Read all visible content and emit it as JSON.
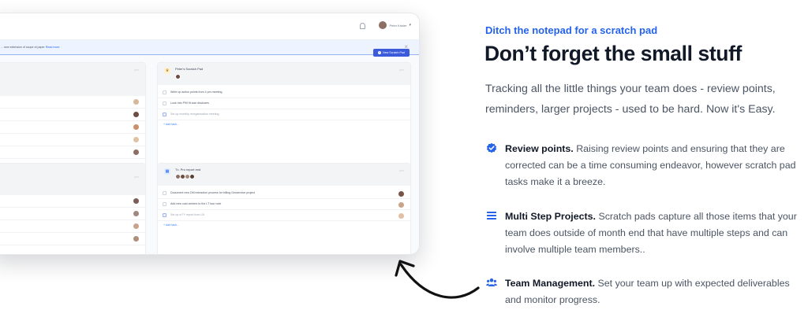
{
  "app": {
    "user_name": "Peter Krisler",
    "banner_text": "... new extension of scope of paper",
    "banner_link": "Read more",
    "new_button": "New Scratch Pad",
    "pads": [
      {
        "title": "Peter's Scratch Pad",
        "tasks": [
          "Write up action points from 4 pm meeting",
          "Look into P90 fit size discloses"
        ],
        "subtask": "Set up monthly reorganisation meeting",
        "add_task": "+ Add task..."
      },
      {
        "title": "Tx. Pro report end",
        "tasks": [
          "Document new DM extraction process for billing Geoservice project",
          "Add new cost centers to the LT tour note"
        ],
        "subtask": "Set up a FY report from LB",
        "add_task": "+ Add task..."
      }
    ]
  },
  "content": {
    "eyebrow": "Ditch the notepad for a scratch pad",
    "headline": "Don’t forget the small stuff",
    "lede": "Tracking all the little things your team does - review points, reminders, larger projects - used to be hard. Now it's Easy.",
    "features": [
      {
        "icon": "check-badge-icon",
        "title": "Review points.",
        "text": "Raising review points and ensuring that they are corrected can be a time consuming endeavor, however scratch pad tasks make it a breeze."
      },
      {
        "icon": "list-icon",
        "title": "Multi Step Projects.",
        "text": "Scratch pads capture all those items that your team does outside of month end that have multiple steps and can involve multiple team members.."
      },
      {
        "icon": "users-icon",
        "title": "Team Management.",
        "text": "Set your team up with expected deliverables and monitor progress."
      }
    ]
  },
  "colors": {
    "accent": "#2563eb",
    "button": "#3b5bdb",
    "headline": "#111827",
    "body": "#4b5563"
  }
}
